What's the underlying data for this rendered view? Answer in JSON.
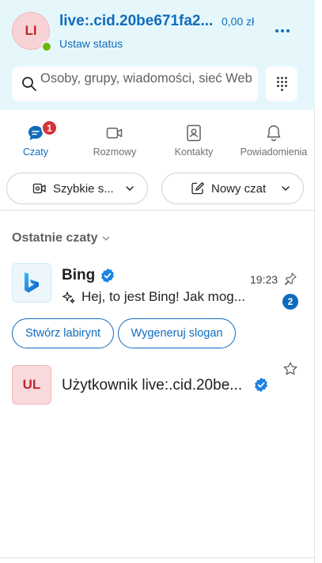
{
  "header": {
    "avatar_initials": "LI",
    "user_name": "live:.cid.20be671fa2...",
    "balance": "0,00 zł",
    "status_label": "Ustaw status",
    "search_placeholder": "Osoby, grupy, wiadomości, sieć Web"
  },
  "tabs": [
    {
      "label": "Czaty",
      "icon": "chat-icon",
      "active": true,
      "badge": "1"
    },
    {
      "label": "Rozmowy",
      "icon": "video-icon",
      "active": false
    },
    {
      "label": "Kontakty",
      "icon": "contacts-icon",
      "active": false
    },
    {
      "label": "Powiadomienia",
      "icon": "bell-icon",
      "active": false
    }
  ],
  "actions": {
    "quick_label": "Szybkie s...",
    "new_chat_label": "Nowy czat"
  },
  "recent": {
    "title": "Ostatnie czaty",
    "chats": [
      {
        "name": "Bing",
        "preview": "Hej, to jest Bing! Jak mog...",
        "time": "19:23",
        "unread": "2",
        "verified": true,
        "suggestions": [
          "Stwórz labirynt",
          "Wygeneruj slogan"
        ]
      },
      {
        "initials": "UL",
        "name": "Użytkownik live:.cid.20be...",
        "verified": true
      }
    ]
  },
  "colors": {
    "accent": "#0f6cbd",
    "header_bg": "#e6f7fb",
    "badge_red": "#d13438",
    "presence_green": "#6bb700"
  }
}
